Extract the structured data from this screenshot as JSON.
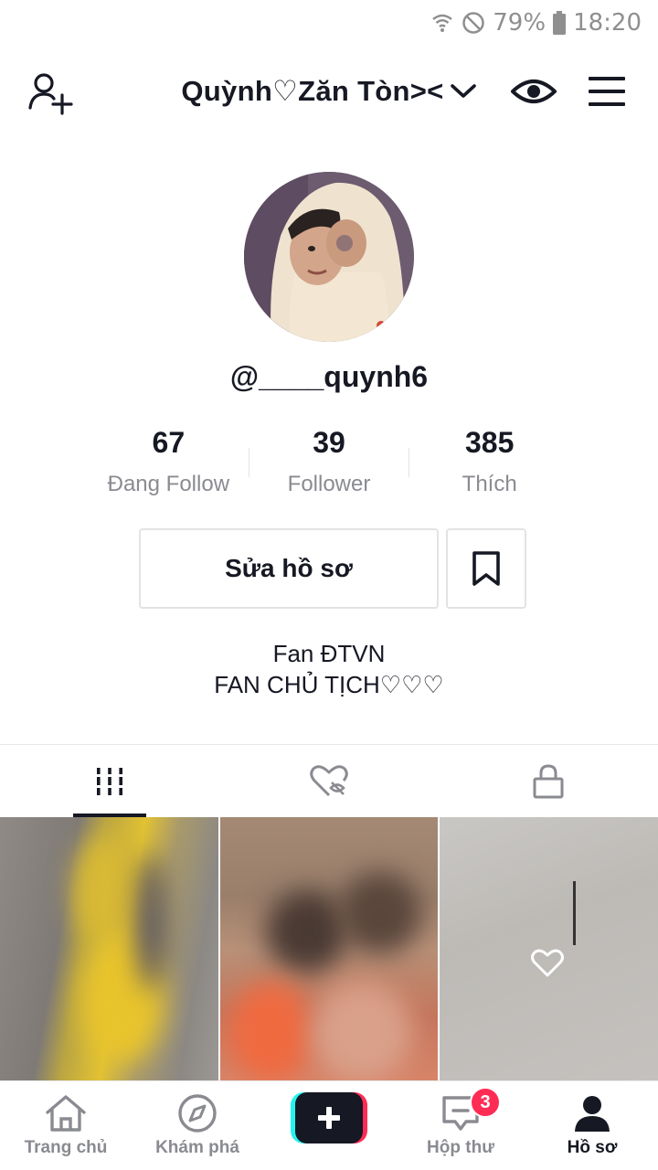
{
  "status_bar": {
    "battery": "79%",
    "time": "18:20"
  },
  "header": {
    "title": "Quỳnh♡Zăn Tòn><"
  },
  "profile": {
    "handle": "@____quynh6"
  },
  "stats": [
    {
      "value": "67",
      "label": "Đang Follow"
    },
    {
      "value": "39",
      "label": "Follower"
    },
    {
      "value": "385",
      "label": "Thích"
    }
  ],
  "actions": {
    "edit_label": "Sửa hồ sơ"
  },
  "bio": {
    "line1": "Fan ĐTVN",
    "line2": "FAN CHỦ TỊCH♡♡♡"
  },
  "tabs": [
    {
      "icon": "grid-icon",
      "active": true
    },
    {
      "icon": "liked-hidden-icon",
      "active": false
    },
    {
      "icon": "lock-icon",
      "active": false
    }
  ],
  "nav": {
    "home": "Trang chủ",
    "discover": "Khám phá",
    "inbox": "Hộp thư",
    "inbox_badge": "3",
    "profile": "Hồ sơ"
  },
  "colors": {
    "accent": "#fe2c55",
    "cyan": "#25f4ee",
    "text": "#161823",
    "muted": "#8a8b91"
  }
}
